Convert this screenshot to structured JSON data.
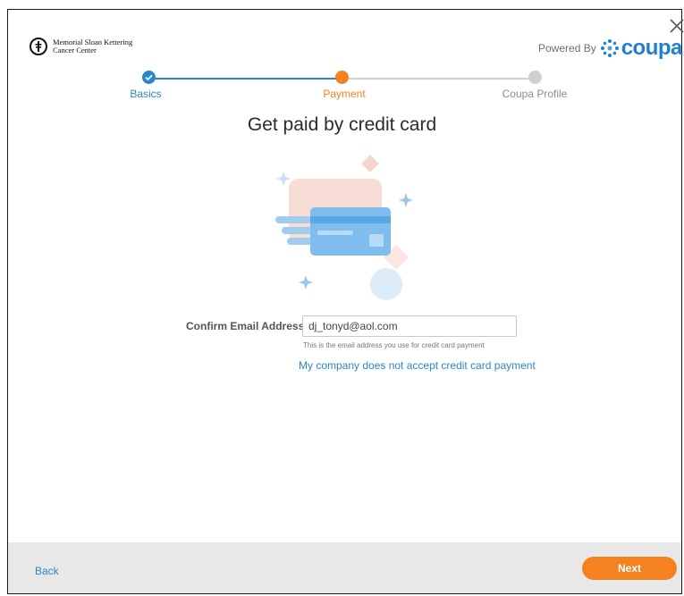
{
  "brand": {
    "org_name_line1": "Memorial Sloan Kettering",
    "org_name_line2": "Cancer Center",
    "powered_by": "Powered By",
    "coupa": "coupa"
  },
  "steps": [
    {
      "label": "Basics",
      "state": "completed",
      "color": "#2a86c8"
    },
    {
      "label": "Payment",
      "state": "current",
      "color": "#f58220"
    },
    {
      "label": "Coupa Profile",
      "state": "upcoming",
      "color": "#c8c8c8"
    }
  ],
  "main": {
    "title": "Get paid by credit card",
    "illustration_icon": "credit-card-illustration"
  },
  "form": {
    "email_label": "Confirm Email Address",
    "email_value": "dj_tonyd@aol.com",
    "email_helper": "This is the email address you use for credit card payment",
    "decline_link": "My company does not accept credit card payment"
  },
  "footer": {
    "back_label": "Back",
    "next_label": "Next"
  },
  "colors": {
    "accent_blue": "#2a86c8",
    "accent_orange": "#f58220",
    "footer_bg": "#e8e8e8"
  }
}
